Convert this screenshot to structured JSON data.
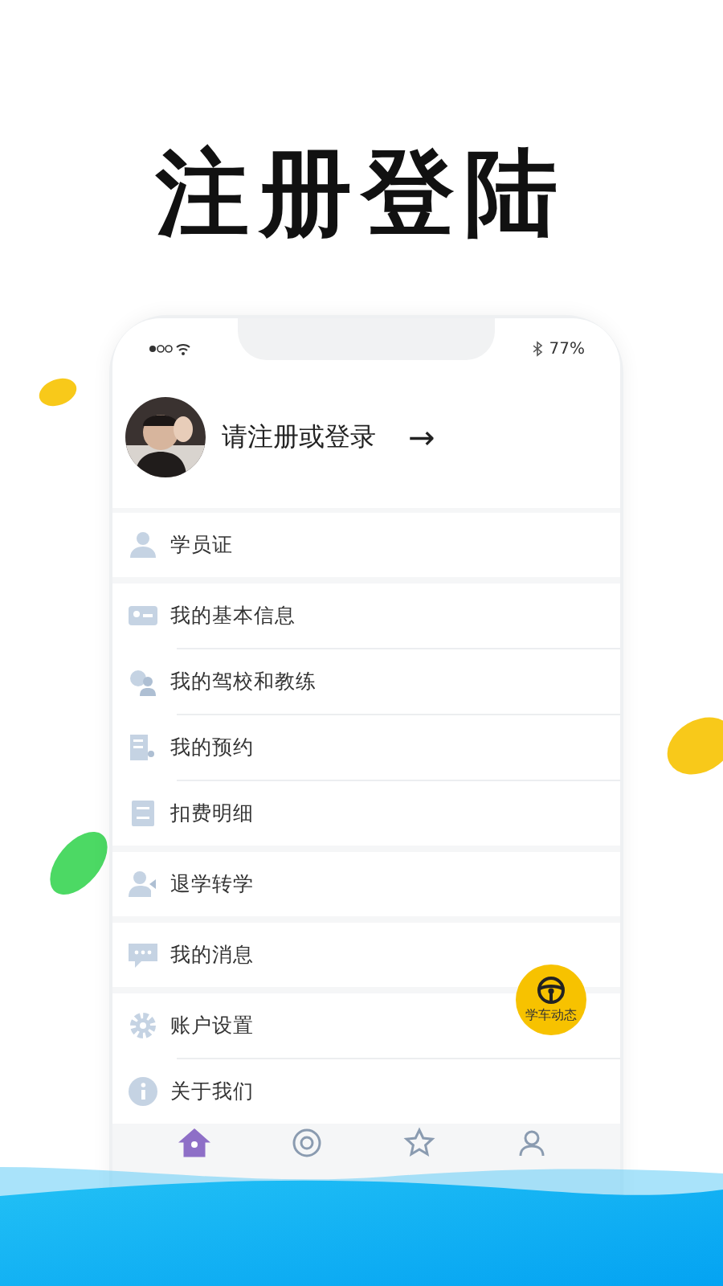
{
  "headline": "注册登陆",
  "status_bar": {
    "battery": "77%"
  },
  "profile": {
    "prompt": "请注册或登录",
    "arrow": "→"
  },
  "menu_groups": [
    {
      "items": [
        {
          "kind": "person",
          "label": "学员证"
        }
      ]
    },
    {
      "items": [
        {
          "kind": "card",
          "label": "我的基本信息"
        },
        {
          "kind": "coach",
          "label": "我的驾校和教练"
        },
        {
          "kind": "booking",
          "label": "我的预约"
        },
        {
          "kind": "list",
          "label": "扣费明细"
        }
      ]
    },
    {
      "items": [
        {
          "kind": "transfer",
          "label": "退学转学"
        }
      ]
    },
    {
      "items": [
        {
          "kind": "message",
          "label": "我的消息"
        }
      ]
    },
    {
      "items": [
        {
          "kind": "gear",
          "label": "账户设置"
        },
        {
          "kind": "info",
          "label": "关于我们"
        }
      ]
    }
  ],
  "floating_button": {
    "label": "学车动态"
  },
  "tabs": [
    {
      "kind": "home",
      "selected": true
    },
    {
      "kind": "camera",
      "selected": false
    },
    {
      "kind": "star",
      "selected": false
    },
    {
      "kind": "person",
      "selected": false
    }
  ]
}
